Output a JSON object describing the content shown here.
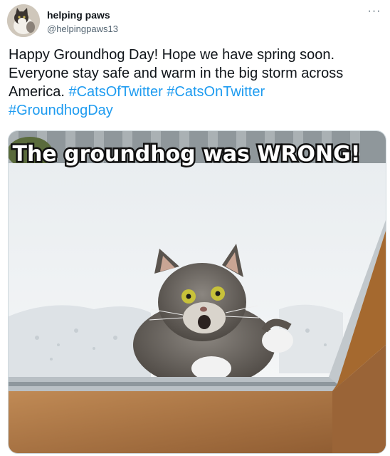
{
  "user": {
    "display_name": "helping paws",
    "handle": "@helpingpaws13"
  },
  "menu": {
    "more_icon": "more-horizontal-icon",
    "more_label": "···"
  },
  "tweet": {
    "text_lines": [
      "Happy Groundhog Day! Hope we have spring soon.",
      "Everyone stay safe and warm in the big storm across",
      "America."
    ],
    "hashtags": [
      "#CatsOfTwitter",
      "#CatsOnTwitter",
      "#GroundhogDay"
    ]
  },
  "media": {
    "caption": "The groundhog was WRONG!"
  },
  "colors": {
    "link": "#1d9bf0",
    "text": "#0f1419",
    "secondary": "#536471"
  }
}
